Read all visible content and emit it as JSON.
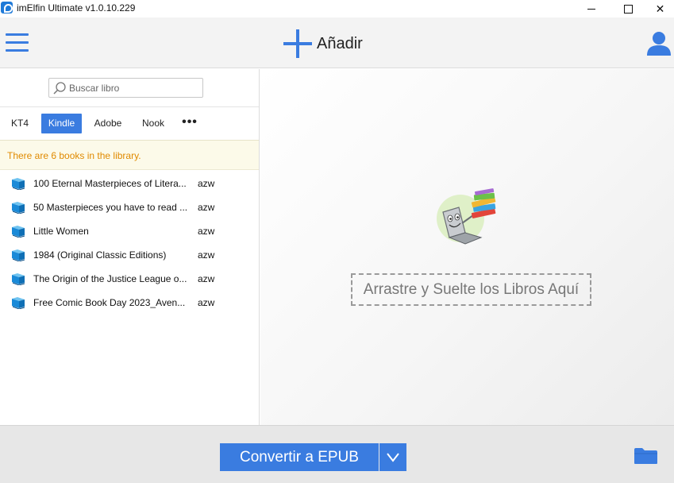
{
  "window": {
    "title": "imElfin Ultimate v1.0.10.229",
    "controls": [
      "minimize-icon",
      "maximize-icon",
      "close-icon"
    ],
    "close_glyph": "✕"
  },
  "toolbar": {
    "add_label": "Añadir",
    "menu_icon": "hamburger-menu-icon",
    "add_icon": "plus-icon",
    "user_icon": "user-account-icon"
  },
  "search": {
    "placeholder": "Buscar libro",
    "value": ""
  },
  "tabs": [
    {
      "label": "KT4",
      "selected": false
    },
    {
      "label": "Kindle",
      "selected": true
    },
    {
      "label": "Adobe",
      "selected": false
    },
    {
      "label": "Nook",
      "selected": false
    },
    {
      "label": "•••",
      "selected": false
    }
  ],
  "library": {
    "info": "There are 6 books in the library.",
    "books": [
      {
        "title": "100 Eternal Masterpieces of Litera...",
        "format": "azw"
      },
      {
        "title": "50 Masterpieces you have to read ...",
        "format": "azw"
      },
      {
        "title": "Little Women",
        "format": "azw"
      },
      {
        "title": "1984 (Original Classic Editions)",
        "format": "azw"
      },
      {
        "title": "The Origin of the Justice League o...",
        "format": "azw"
      },
      {
        "title": "Free Comic Book Day 2023_Aven...",
        "format": "azw"
      }
    ]
  },
  "drop_area": {
    "label": "Arrastre y Suelte los Libros Aquí",
    "illustration": "reading-mascot-with-books"
  },
  "bottom": {
    "convert_label": "Convertir a EPUB",
    "dropdown_icon": "chevron-down-icon",
    "folder_icon": "folder-icon"
  },
  "colors": {
    "accent": "#3a7ce0",
    "info_text": "#e08a00",
    "info_background": "#fcfae9"
  }
}
